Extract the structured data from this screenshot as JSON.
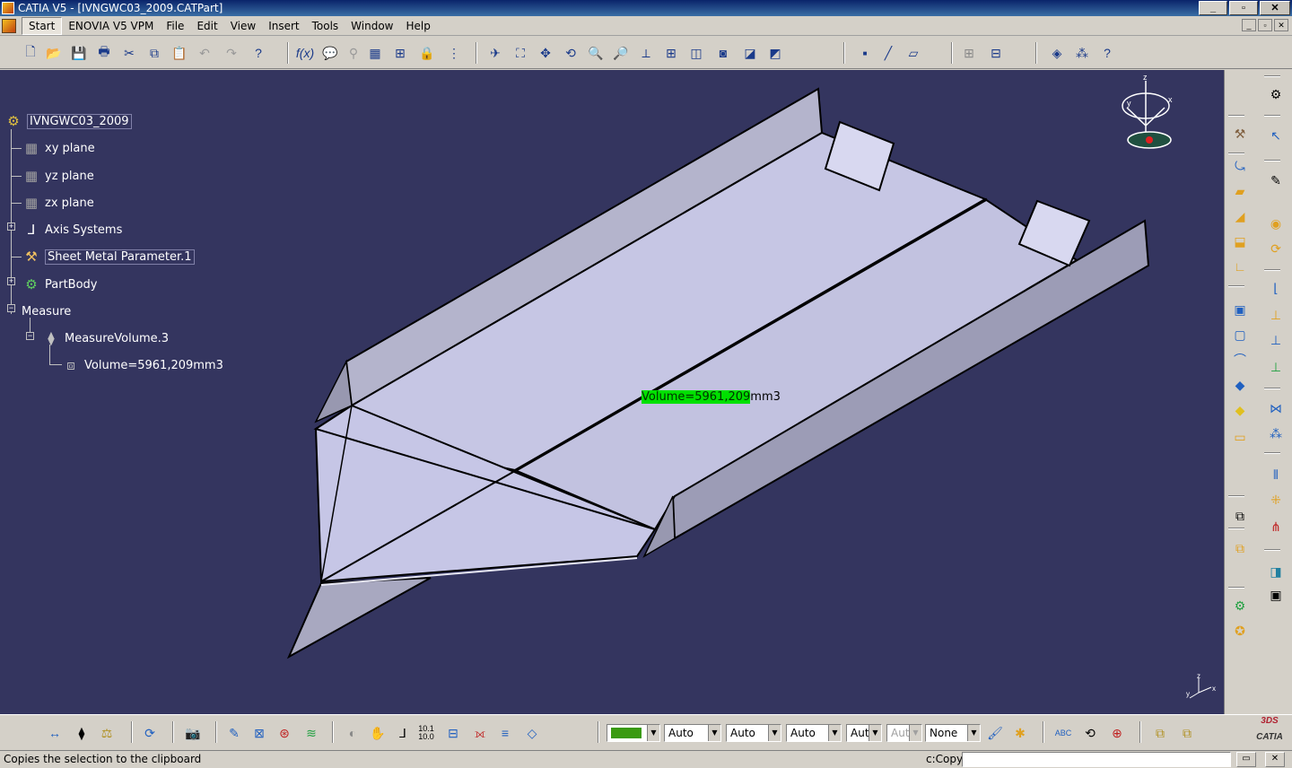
{
  "window": {
    "title": "CATIA V5 - [IVNGWC03_2009.CATPart]"
  },
  "menu": [
    "Start",
    "ENOVIA V5 VPM",
    "File",
    "Edit",
    "View",
    "Insert",
    "Tools",
    "Window",
    "Help"
  ],
  "tree": {
    "root": "IVNGWC03_2009",
    "xy": "xy plane",
    "yz": "yz plane",
    "zx": "zx plane",
    "axis": "Axis Systems",
    "sheet": "Sheet Metal Parameter.1",
    "partbody": "PartBody",
    "measure": "Measure",
    "measure_volume": "MeasureVolume.3",
    "volume": "Volume=5961,209mm3"
  },
  "viewport": {
    "volume_highlight": "Volume=5961,209",
    "volume_unit": "mm3",
    "compass_labels": {
      "z": "z",
      "x": "x",
      "y": "y"
    }
  },
  "bottom": {
    "swatch_color": "#3a9a10",
    "combo1": "Auto",
    "combo2": "Auto",
    "combo3": "Auto",
    "combo4": "Aut",
    "combo5": "Aut",
    "combo6": "None",
    "ratio1": "10.1",
    "ratio2": "10.0"
  },
  "status": {
    "text": "Copies the selection to the clipboard",
    "command_label": "c:Copy"
  },
  "logo": {
    "line1": "3DS",
    "line2": "CATIA"
  }
}
